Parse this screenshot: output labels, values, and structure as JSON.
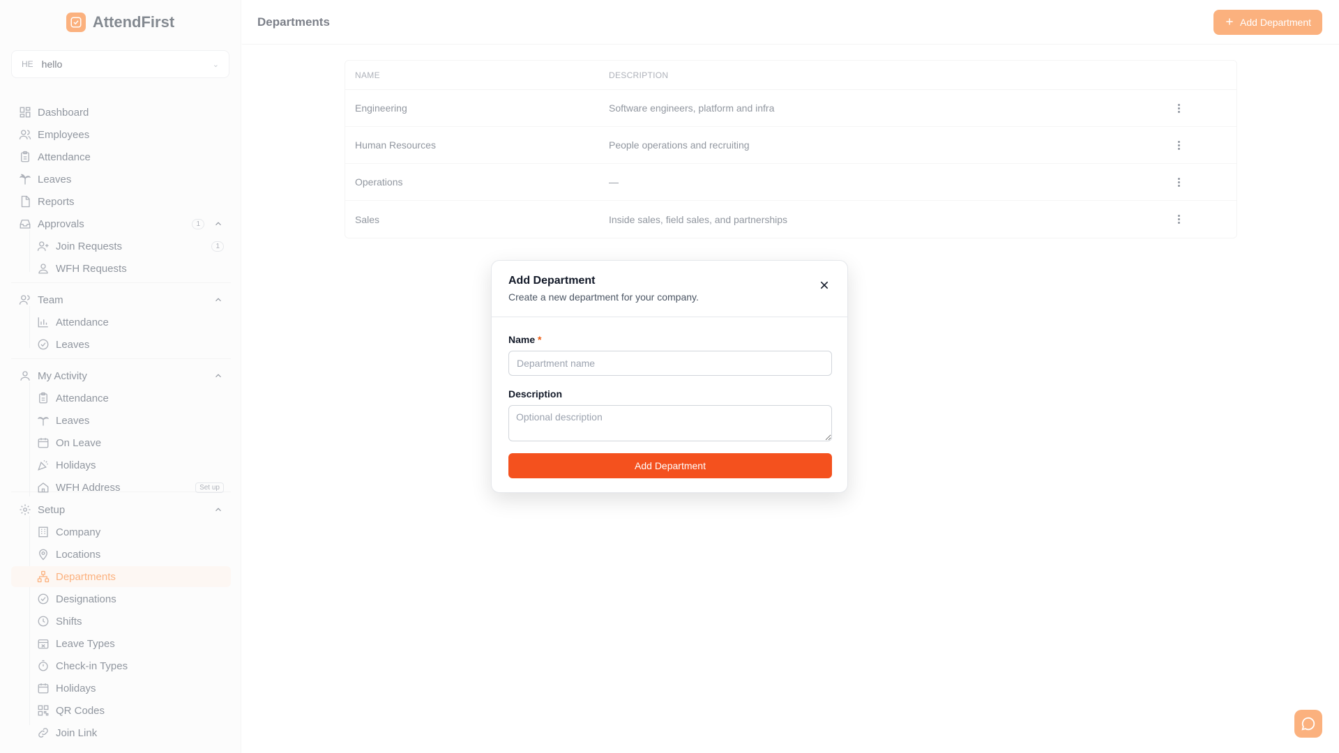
{
  "app": {
    "name": "AttendFirst"
  },
  "org": {
    "abbr": "HE",
    "name": "hello"
  },
  "sidebar": {
    "items": [
      {
        "label": "Dashboard",
        "icon": "dashboard-icon"
      },
      {
        "label": "Employees",
        "icon": "users-icon"
      },
      {
        "label": "Attendance",
        "icon": "clipboard-icon"
      },
      {
        "label": "Leaves",
        "icon": "palm-tree-icon"
      },
      {
        "label": "Reports",
        "icon": "file-icon"
      },
      {
        "label": "Approvals",
        "icon": "inbox-icon",
        "badge": "1"
      },
      {
        "label": "Join Requests",
        "icon": "user-plus-icon",
        "badge": "1"
      },
      {
        "label": "WFH Requests",
        "icon": "user-location-icon"
      },
      {
        "label": "Team",
        "icon": "team-icon"
      },
      {
        "label": "Attendance",
        "icon": "bar-chart-icon"
      },
      {
        "label": "Leaves",
        "icon": "check-circle-icon"
      },
      {
        "label": "My Activity",
        "icon": "user-icon"
      },
      {
        "label": "Attendance",
        "icon": "clipboard-icon"
      },
      {
        "label": "Leaves",
        "icon": "palm-tree-icon"
      },
      {
        "label": "On Leave",
        "icon": "calendar-icon"
      },
      {
        "label": "Holidays",
        "icon": "party-icon"
      },
      {
        "label": "WFH Address",
        "icon": "home-icon",
        "badge": "Set up"
      },
      {
        "label": "Setup",
        "icon": "gear-icon"
      },
      {
        "label": "Company",
        "icon": "building-icon"
      },
      {
        "label": "Locations",
        "icon": "map-pin-icon"
      },
      {
        "label": "Departments",
        "icon": "org-chart-icon"
      },
      {
        "label": "Designations",
        "icon": "badge-check-icon"
      },
      {
        "label": "Shifts",
        "icon": "clock-icon"
      },
      {
        "label": "Leave Types",
        "icon": "calendar-x-icon"
      },
      {
        "label": "Check-in Types",
        "icon": "timer-icon"
      },
      {
        "label": "Holidays",
        "icon": "calendar-icon"
      },
      {
        "label": "QR Codes",
        "icon": "qr-code-icon"
      },
      {
        "label": "Join Link",
        "icon": "link-icon"
      }
    ]
  },
  "header": {
    "title": "Departments",
    "add_label": "Add Department"
  },
  "table": {
    "columns": [
      "NAME",
      "DESCRIPTION"
    ],
    "rows": [
      {
        "name": "Engineering",
        "description": "Software engineers, platform and infra"
      },
      {
        "name": "Human Resources",
        "description": "People operations and recruiting"
      },
      {
        "name": "Operations",
        "description": "—"
      },
      {
        "name": "Sales",
        "description": "Inside sales, field sales, and partnerships"
      }
    ]
  },
  "modal": {
    "title": "Add Department",
    "subtitle": "Create a new department for your company.",
    "name_label": "Name",
    "required_mark": "*",
    "name_placeholder": "Department name",
    "name_value": "",
    "description_label": "Description",
    "description_placeholder": "Optional description",
    "description_value": "",
    "submit_label": "Add Department"
  },
  "colors": {
    "accent": "#f97316",
    "submit": "#f4511e"
  }
}
